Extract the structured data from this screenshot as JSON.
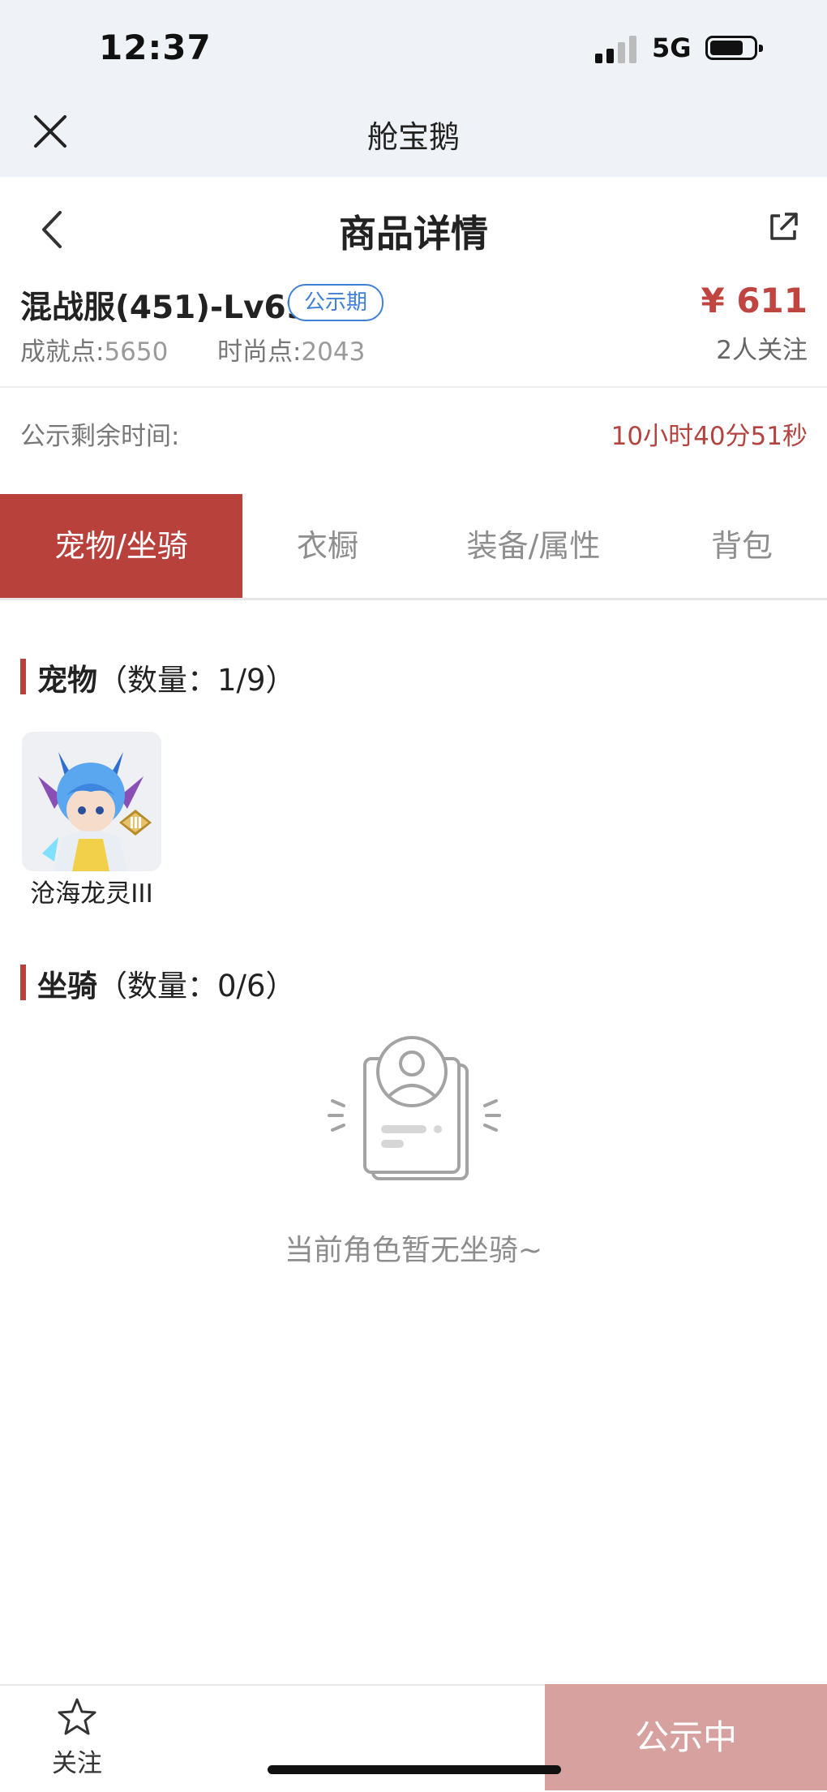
{
  "status_bar": {
    "time": "12:37",
    "network": "5G"
  },
  "mini_program": {
    "title": "舱宝鹅"
  },
  "header": {
    "title": "商品详情"
  },
  "product": {
    "server_level": "混战服(451)-Lv69",
    "badge": "公示期",
    "price": "¥ 611",
    "achievement_label": "成就点:",
    "achievement_value": "5650",
    "fashion_label": "时尚点:",
    "fashion_value": "2043",
    "watchers": "2人关注",
    "remaining_label": "公示剩余时间:",
    "remaining_value": "10小时40分51秒"
  },
  "tabs": [
    {
      "label": "宠物/坐骑",
      "active": true
    },
    {
      "label": "衣橱",
      "active": false
    },
    {
      "label": "装备/属性",
      "active": false
    },
    {
      "label": "背包",
      "active": false
    }
  ],
  "pets_section": {
    "title": "宠物",
    "count": "（数量：1/9）",
    "items": [
      {
        "name": "沧海龙灵III"
      }
    ]
  },
  "mounts_section": {
    "title": "坐骑",
    "count": "（数量：0/6）",
    "empty_text": "当前角色暂无坐骑~"
  },
  "bottom": {
    "favorite_label": "关注",
    "status_button": "公示中"
  },
  "colors": {
    "accent": "#b8413c",
    "price": "#c0443f",
    "badge": "#3f7fd6",
    "disabled_button": "#d6a19f"
  },
  "icons": [
    "close-icon",
    "back-icon",
    "share-icon",
    "star-icon",
    "empty-state-icon",
    "signal-icon",
    "battery-icon"
  ]
}
